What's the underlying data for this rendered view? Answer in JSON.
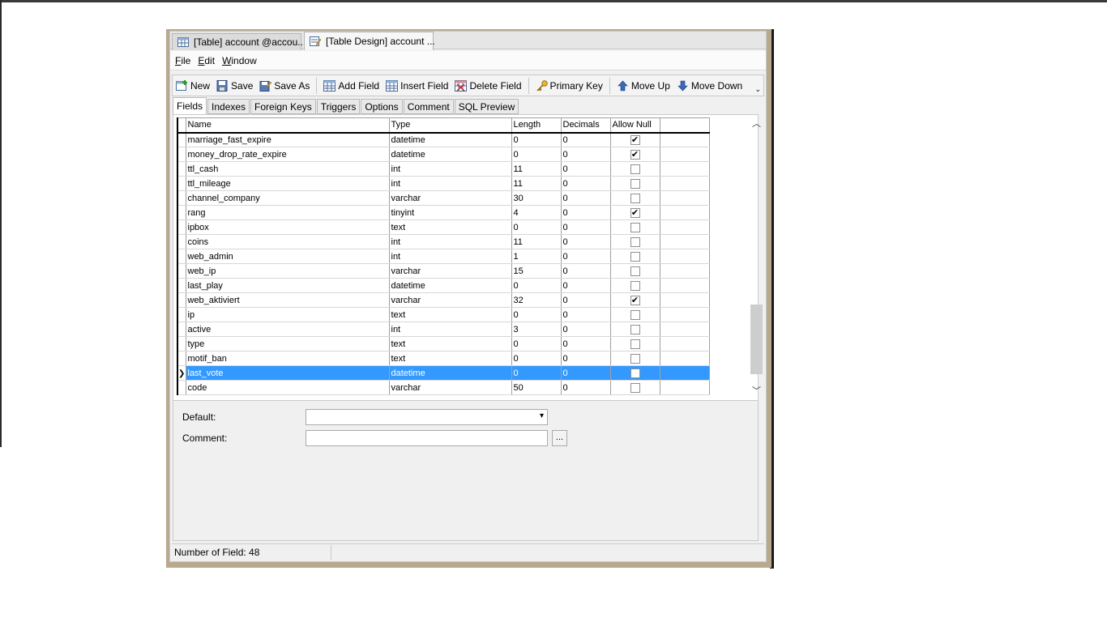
{
  "tabs": [
    {
      "label": "[Table] account @accou...",
      "active": false
    },
    {
      "label": "[Table Design] account ...",
      "active": true
    }
  ],
  "menu": [
    "File",
    "Edit",
    "Window"
  ],
  "toolbar": {
    "new": "New",
    "save": "Save",
    "save_as": "Save As",
    "add_field": "Add Field",
    "insert_field": "Insert Field",
    "delete_field": "Delete Field",
    "primary_key": "Primary Key",
    "move_up": "Move Up",
    "move_down": "Move Down",
    "more": "⌄"
  },
  "subtabs": [
    "Fields",
    "Indexes",
    "Foreign Keys",
    "Triggers",
    "Options",
    "Comment",
    "SQL Preview"
  ],
  "grid": {
    "headers": [
      "Name",
      "Type",
      "Length",
      "Decimals",
      "Allow Null",
      ""
    ],
    "rows": [
      {
        "name": "marriage_fast_expire",
        "type": "datetime",
        "length": "0",
        "decimals": "0",
        "null": true
      },
      {
        "name": "money_drop_rate_expire",
        "type": "datetime",
        "length": "0",
        "decimals": "0",
        "null": true
      },
      {
        "name": "ttl_cash",
        "type": "int",
        "length": "11",
        "decimals": "0",
        "null": false
      },
      {
        "name": "ttl_mileage",
        "type": "int",
        "length": "11",
        "decimals": "0",
        "null": false
      },
      {
        "name": "channel_company",
        "type": "varchar",
        "length": "30",
        "decimals": "0",
        "null": false
      },
      {
        "name": "rang",
        "type": "tinyint",
        "length": "4",
        "decimals": "0",
        "null": true
      },
      {
        "name": "ipbox",
        "type": "text",
        "length": "0",
        "decimals": "0",
        "null": false
      },
      {
        "name": "coins",
        "type": "int",
        "length": "11",
        "decimals": "0",
        "null": false
      },
      {
        "name": "web_admin",
        "type": "int",
        "length": "1",
        "decimals": "0",
        "null": false
      },
      {
        "name": "web_ip",
        "type": "varchar",
        "length": "15",
        "decimals": "0",
        "null": false
      },
      {
        "name": "last_play",
        "type": "datetime",
        "length": "0",
        "decimals": "0",
        "null": false
      },
      {
        "name": "web_aktiviert",
        "type": "varchar",
        "length": "32",
        "decimals": "0",
        "null": true
      },
      {
        "name": "ip",
        "type": "text",
        "length": "0",
        "decimals": "0",
        "null": false
      },
      {
        "name": "active",
        "type": "int",
        "length": "3",
        "decimals": "0",
        "null": false
      },
      {
        "name": "type",
        "type": "text",
        "length": "0",
        "decimals": "0",
        "null": false
      },
      {
        "name": "motif_ban",
        "type": "text",
        "length": "0",
        "decimals": "0",
        "null": false
      },
      {
        "name": "last_vote",
        "type": "datetime",
        "length": "0",
        "decimals": "0",
        "null": false,
        "selected": true
      },
      {
        "name": "code",
        "type": "varchar",
        "length": "50",
        "decimals": "0",
        "null": false
      }
    ]
  },
  "properties": {
    "default_label": "Default:",
    "default_value": "",
    "comment_label": "Comment:",
    "comment_value": "",
    "ellipsis": "..."
  },
  "status": {
    "field_count": "Number of Field: 48"
  },
  "colors": {
    "selection": "#3399ff",
    "window_frame": "#b8a98e"
  }
}
